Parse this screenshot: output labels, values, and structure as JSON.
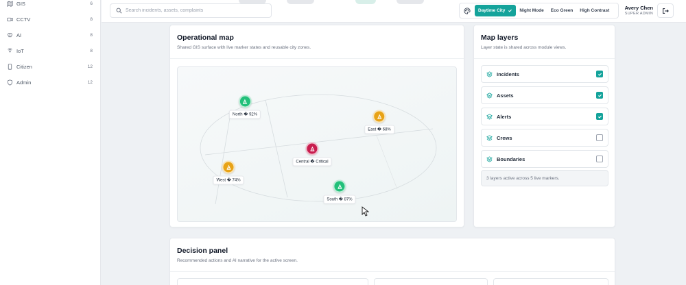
{
  "sidebar": {
    "items": [
      {
        "label": "GIS",
        "count": "6",
        "icon": "map-icon"
      },
      {
        "label": "CCTV",
        "count": "8",
        "icon": "camera-icon"
      },
      {
        "label": "AI",
        "count": "8",
        "icon": "brain-icon"
      },
      {
        "label": "IoT",
        "count": "8",
        "icon": "signal-icon"
      },
      {
        "label": "Citizen",
        "count": "12",
        "icon": "phone-icon"
      },
      {
        "label": "Admin",
        "count": "12",
        "icon": "shield-icon"
      }
    ]
  },
  "header": {
    "search_placeholder": "Search incidents, assets, complaints",
    "themes": [
      {
        "label": "Daytime City",
        "active": true
      },
      {
        "label": "Night Mode",
        "active": false
      },
      {
        "label": "Eco Green",
        "active": false
      },
      {
        "label": "High Contrast",
        "active": false
      }
    ],
    "user": {
      "name": "Avery Chen",
      "role": "SUPER ADMIN"
    }
  },
  "map_card": {
    "title": "Operational map",
    "subtitle": "Shared GIS surface with live marker states and reusable city zones.",
    "markers": [
      {
        "label": "North � 92%",
        "status": "ok",
        "color": "#22c07a"
      },
      {
        "label": "East � 68%",
        "status": "warning",
        "color": "#e8a317"
      },
      {
        "label": "Central � Critical",
        "status": "critical",
        "color": "#c81d4e"
      },
      {
        "label": "West � 74%",
        "status": "warning",
        "color": "#e8a317"
      },
      {
        "label": "South � 87%",
        "status": "ok",
        "color": "#22c07a"
      }
    ]
  },
  "layers_card": {
    "title": "Map layers",
    "subtitle": "Layer state is shared across module views.",
    "layers": [
      {
        "label": "Incidents",
        "checked": true
      },
      {
        "label": "Assets",
        "checked": true
      },
      {
        "label": "Alerts",
        "checked": true
      },
      {
        "label": "Crews",
        "checked": false
      },
      {
        "label": "Boundaries",
        "checked": false
      }
    ],
    "summary": "3 layers active across 5 live markers."
  },
  "decision_card": {
    "title": "Decision panel",
    "subtitle": "Recommended actions and AI narrative for the active screen."
  },
  "colors": {
    "accent": "#14a39b",
    "ok": "#22c07a",
    "warning": "#e8a317",
    "critical": "#c81d4e"
  }
}
